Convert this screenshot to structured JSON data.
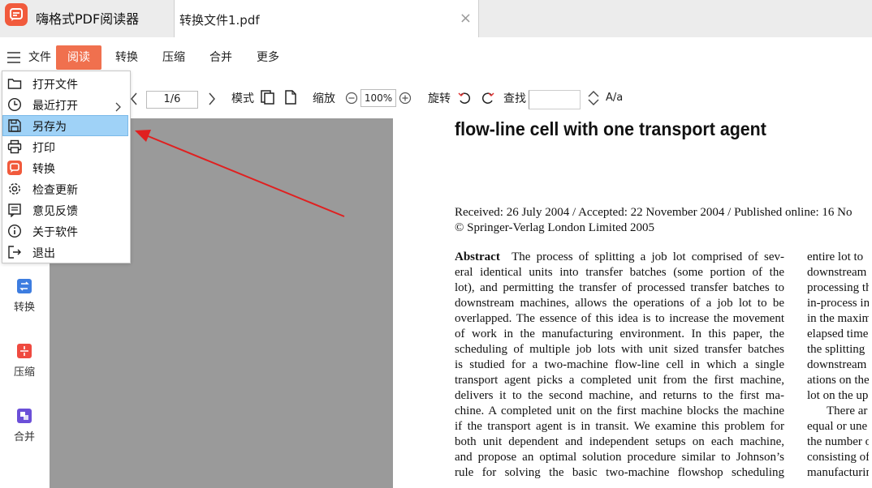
{
  "app": {
    "title": "嗨格式PDF阅读器"
  },
  "tab": {
    "label": "转换文件1.pdf",
    "close": "×"
  },
  "menu": {
    "file": "文件",
    "read": "阅读",
    "convert": "转换",
    "compress": "压缩",
    "merge": "合并",
    "more": "更多"
  },
  "toolbar": {
    "page": "1/6",
    "mode": "模式",
    "zoom_label": "缩放",
    "zoom_value": "100%",
    "rotate": "旋转",
    "find": "查找",
    "case": "A/a"
  },
  "dropdown": {
    "items": [
      {
        "label": "打开文件",
        "icon": "folder-icon"
      },
      {
        "label": "最近打开",
        "icon": "clock-icon"
      },
      {
        "label": "另存为",
        "icon": "save-icon"
      },
      {
        "label": "打印",
        "icon": "printer-icon"
      },
      {
        "label": "转换",
        "icon": "convert-app-icon"
      },
      {
        "label": "检查更新",
        "icon": "gear-icon"
      },
      {
        "label": "意见反馈",
        "icon": "feedback-icon"
      },
      {
        "label": "关于软件",
        "icon": "info-icon"
      },
      {
        "label": "退出",
        "icon": "exit-icon"
      }
    ],
    "selected_index": 2
  },
  "sidebar": {
    "items": [
      {
        "label": "转换",
        "color": "#3d7de0"
      },
      {
        "label": "压缩",
        "color": "#ef4a40"
      },
      {
        "label": "合并",
        "color": "#6b4fd8"
      }
    ]
  },
  "colors": {
    "accent": "#f0704e",
    "selection": "#9fd2f7",
    "arrow": "#e02020"
  },
  "document": {
    "title": "flow-line cell with one transport agent",
    "received": "Received: 26 July 2004 / Accepted: 22 November 2004 / Published online: 16 No",
    "copyright": "© Springer-Verlag London Limited 2005",
    "abstract_label": "Abstract",
    "col1": [
      "The process of splitting a job lot comprised of sev-",
      "eral identical units into transfer batches (some portion of the",
      "lot), and permitting the transfer of processed transfer batches to",
      "downstream machines, allows the operations of a job lot to be",
      "overlapped. The essence of this idea is to increase the movement",
      "of work in the manufacturing environment. In this paper, the",
      "scheduling of multiple job lots with unit sized transfer batches",
      "is studied for a two-machine flow-line cell in which a single",
      "transport agent picks a completed unit from the first machine,",
      "delivers it to the second machine, and returns to the first ma-",
      "chine. A completed unit on the first machine blocks the machine",
      "if the transport agent is in transit. We examine this problem for",
      "both unit dependent and independent setups on each machine,",
      "and propose an optimal solution procedure similar to Johnson’s",
      "rule for solving the basic two-machine flowshop scheduling"
    ],
    "col2": [
      "entire lot to",
      "downstream",
      "processing th",
      "in-process in",
      "in the maxim",
      "elapsed time",
      "the splitting",
      "downstream",
      "ations on the",
      "lot on the up",
      "There ar",
      "equal or une",
      "the number o",
      "consisting of",
      "manufacturin"
    ]
  }
}
